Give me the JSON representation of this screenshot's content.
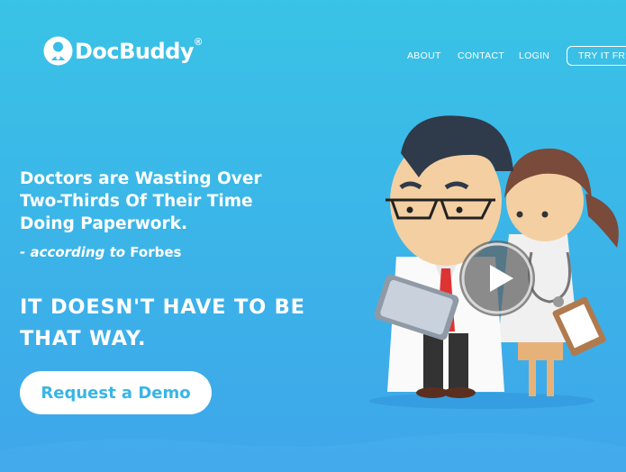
{
  "brand": {
    "name": "DocBuddy",
    "reg": "®",
    "icon": "docbuddy-logo-icon"
  },
  "nav": {
    "about": "ABOUT",
    "contact": "CONTACT",
    "login": "LOGIN",
    "try": "TRY IT FREE"
  },
  "hero": {
    "headline": "Doctors are Wasting Over Two-Thirds Of Their Time Doing Paperwork.",
    "attribution_prefix": "- according to",
    "attribution_source": "Forbes",
    "tagline": "IT DOESN'T HAVE TO BE THAT WAY.",
    "cta": "Request a Demo"
  },
  "media": {
    "play_icon": "play-icon"
  },
  "colors": {
    "accent": "#39b5e6",
    "background_top": "#39c3e6",
    "background_bottom": "#3ea6ea"
  }
}
